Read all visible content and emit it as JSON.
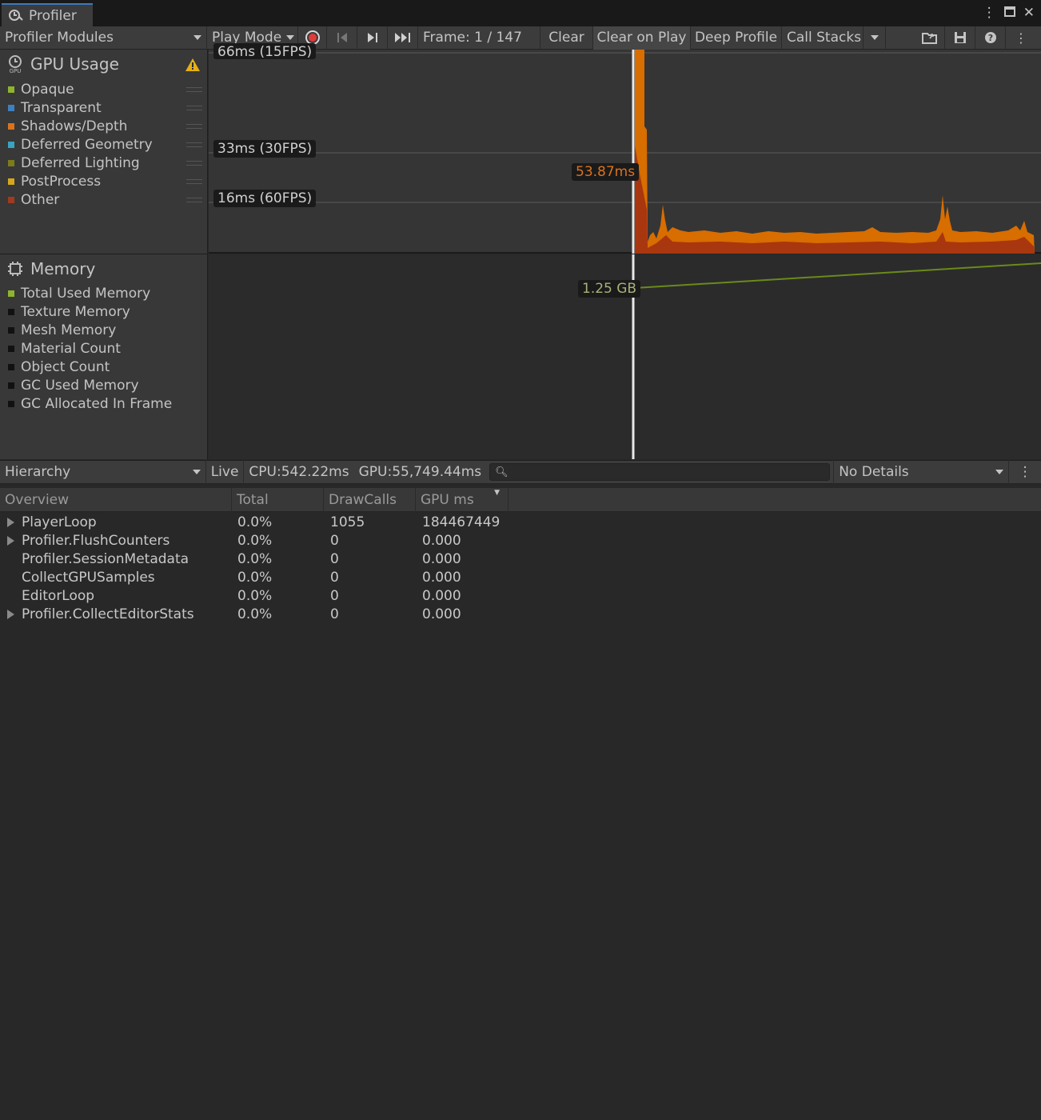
{
  "window": {
    "title": "Profiler"
  },
  "toolbar": {
    "modules_label": "Profiler Modules",
    "play_mode_label": "Play Mode",
    "frame_label": "Frame: 1 / 147",
    "clear_label": "Clear",
    "clear_on_play_label": "Clear on Play",
    "deep_profile_label": "Deep Profile",
    "call_stacks_label": "Call Stacks"
  },
  "gpu_module": {
    "title": "GPU Usage",
    "items": [
      {
        "label": "Opaque",
        "color": "#8db42f"
      },
      {
        "label": "Transparent",
        "color": "#3f7fbf"
      },
      {
        "label": "Shadows/Depth",
        "color": "#d9731f"
      },
      {
        "label": "Deferred Geometry",
        "color": "#39a3c1"
      },
      {
        "label": "Deferred Lighting",
        "color": "#7c7c1c"
      },
      {
        "label": "PostProcess",
        "color": "#d6a71e"
      },
      {
        "label": "Other",
        "color": "#a33a1d"
      }
    ]
  },
  "memory_module": {
    "title": "Memory",
    "items": [
      {
        "label": "Total Used Memory",
        "color": "#8db42f"
      },
      {
        "label": "Texture Memory",
        "color": "#111111"
      },
      {
        "label": "Mesh Memory",
        "color": "#111111"
      },
      {
        "label": "Material Count",
        "color": "#111111"
      },
      {
        "label": "Object Count",
        "color": "#111111"
      },
      {
        "label": "GC Used Memory",
        "color": "#111111"
      },
      {
        "label": "GC Allocated In Frame",
        "color": "#111111"
      }
    ]
  },
  "gpu_chart_labels": {
    "line_66": "66ms (15FPS)",
    "line_33": "33ms (30FPS)",
    "line_16": "16ms (60FPS)",
    "selected_value": "53.87ms"
  },
  "memory_chart_labels": {
    "selected_value": "1.25 GB"
  },
  "hierarchy_bar": {
    "view_label": "Hierarchy",
    "live_label": "Live",
    "cpu_label": "CPU:542.22ms",
    "gpu_label": "GPU:55,749.44ms",
    "details_label": "No Details"
  },
  "table": {
    "headers": {
      "overview": "Overview",
      "total": "Total",
      "drawcalls": "DrawCalls",
      "gpu_ms": "GPU ms"
    },
    "rows": [
      {
        "name": "PlayerLoop",
        "total": "0.0%",
        "drawcalls": "1055",
        "gpu_ms": "184467449",
        "expandable": true
      },
      {
        "name": "Profiler.FlushCounters",
        "total": "0.0%",
        "drawcalls": "0",
        "gpu_ms": "0.000",
        "expandable": true
      },
      {
        "name": "Profiler.SessionMetadata",
        "total": "0.0%",
        "drawcalls": "0",
        "gpu_ms": "0.000",
        "expandable": false
      },
      {
        "name": "CollectGPUSamples",
        "total": "0.0%",
        "drawcalls": "0",
        "gpu_ms": "0.000",
        "expandable": false
      },
      {
        "name": "EditorLoop",
        "total": "0.0%",
        "drawcalls": "0",
        "gpu_ms": "0.000",
        "expandable": false
      },
      {
        "name": "Profiler.CollectEditorStats",
        "total": "0.0%",
        "drawcalls": "0",
        "gpu_ms": "0.000",
        "expandable": true
      }
    ]
  },
  "colors": {
    "gpu_fill_orange": "#d86d00",
    "gpu_fill_red": "#a8360f",
    "memory_line": "#6a8a1a",
    "accent_tab": "#3a79bb"
  }
}
